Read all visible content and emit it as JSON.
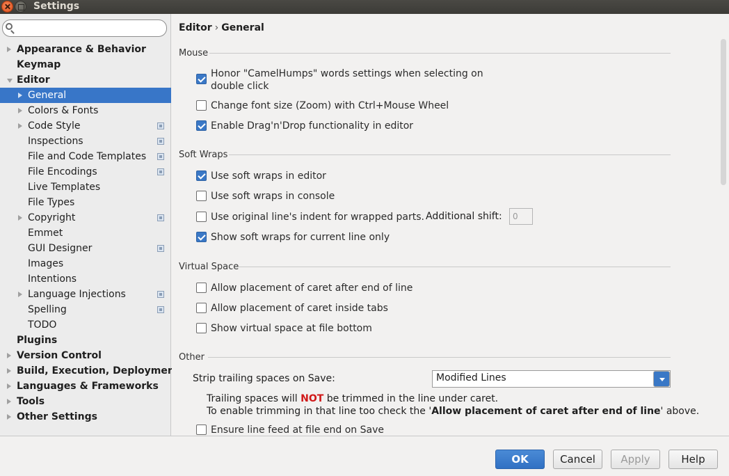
{
  "window": {
    "title": "Settings"
  },
  "search": {
    "placeholder": "",
    "icon": "search-icon"
  },
  "sidebar": {
    "items": [
      {
        "label": "Appearance & Behavior",
        "level": 0,
        "arrow": "right",
        "proj": false,
        "selected": false
      },
      {
        "label": "Keymap",
        "level": 0,
        "arrow": "none",
        "proj": false,
        "selected": false
      },
      {
        "label": "Editor",
        "level": 0,
        "arrow": "down",
        "proj": false,
        "selected": false
      },
      {
        "label": "General",
        "level": 1,
        "arrow": "right",
        "proj": false,
        "selected": true
      },
      {
        "label": "Colors & Fonts",
        "level": 1,
        "arrow": "right",
        "proj": false,
        "selected": false
      },
      {
        "label": "Code Style",
        "level": 1,
        "arrow": "right",
        "proj": true,
        "selected": false
      },
      {
        "label": "Inspections",
        "level": 1,
        "arrow": "none",
        "proj": true,
        "selected": false
      },
      {
        "label": "File and Code Templates",
        "level": 1,
        "arrow": "none",
        "proj": true,
        "selected": false
      },
      {
        "label": "File Encodings",
        "level": 1,
        "arrow": "none",
        "proj": true,
        "selected": false
      },
      {
        "label": "Live Templates",
        "level": 1,
        "arrow": "none",
        "proj": false,
        "selected": false
      },
      {
        "label": "File Types",
        "level": 1,
        "arrow": "none",
        "proj": false,
        "selected": false
      },
      {
        "label": "Copyright",
        "level": 1,
        "arrow": "right",
        "proj": true,
        "selected": false
      },
      {
        "label": "Emmet",
        "level": 1,
        "arrow": "none",
        "proj": false,
        "selected": false
      },
      {
        "label": "GUI Designer",
        "level": 1,
        "arrow": "none",
        "proj": true,
        "selected": false
      },
      {
        "label": "Images",
        "level": 1,
        "arrow": "none",
        "proj": false,
        "selected": false
      },
      {
        "label": "Intentions",
        "level": 1,
        "arrow": "none",
        "proj": false,
        "selected": false
      },
      {
        "label": "Language Injections",
        "level": 1,
        "arrow": "right",
        "proj": true,
        "selected": false
      },
      {
        "label": "Spelling",
        "level": 1,
        "arrow": "none",
        "proj": true,
        "selected": false
      },
      {
        "label": "TODO",
        "level": 1,
        "arrow": "none",
        "proj": false,
        "selected": false
      },
      {
        "label": "Plugins",
        "level": 0,
        "arrow": "none",
        "proj": false,
        "selected": false
      },
      {
        "label": "Version Control",
        "level": 0,
        "arrow": "right",
        "proj": false,
        "selected": false
      },
      {
        "label": "Build, Execution, Deployment",
        "level": 0,
        "arrow": "right",
        "proj": false,
        "selected": false
      },
      {
        "label": "Languages & Frameworks",
        "level": 0,
        "arrow": "right",
        "proj": false,
        "selected": false
      },
      {
        "label": "Tools",
        "level": 0,
        "arrow": "right",
        "proj": false,
        "selected": false
      },
      {
        "label": "Other Settings",
        "level": 0,
        "arrow": "right",
        "proj": false,
        "selected": false
      }
    ]
  },
  "breadcrumb": {
    "parent": "Editor",
    "sep": "›",
    "current": "General"
  },
  "sections": {
    "mouse": "Mouse",
    "soft_wraps": "Soft Wraps",
    "virtual_space": "Virtual Space",
    "other": "Other"
  },
  "options": {
    "camel_humps_l1": "Honor \"CamelHumps\" words settings when selecting on",
    "camel_humps_l2": "double click",
    "camel_humps": true,
    "zoom": "Change font size (Zoom) with Ctrl+Mouse Wheel",
    "zoom_checked": false,
    "dnd": "Enable Drag'n'Drop functionality in editor",
    "dnd_checked": true,
    "wrap_editor": "Use soft wraps in editor",
    "wrap_editor_checked": true,
    "wrap_console": "Use soft wraps in console",
    "wrap_console_checked": false,
    "orig_indent": "Use original line's indent for wrapped parts.",
    "orig_indent_checked": false,
    "additional_shift_label": "Additional shift:",
    "additional_shift_value": "0",
    "wrap_current": "Show soft wraps for current line only",
    "wrap_current_checked": true,
    "caret_after_eol": "Allow placement of caret after end of line",
    "caret_after_eol_checked": false,
    "caret_tabs": "Allow placement of caret inside tabs",
    "caret_tabs_checked": false,
    "virtual_bottom": "Show virtual space at file bottom",
    "virtual_bottom_checked": false,
    "strip_label": "Strip trailing spaces on Save:",
    "strip_value": "Modified Lines",
    "note1_pre": "Trailing spaces will",
    "note1_not": "NOT",
    "note1_post": "be trimmed in the line under caret.",
    "note2_pre": "To enable trimming in that line too check the '",
    "note2_bold": "Allow placement of caret after end of line",
    "note2_post": "' above.",
    "line_feed": "Ensure line feed at file end on Save",
    "line_feed_checked": false
  },
  "buttons": {
    "ok": "OK",
    "cancel": "Cancel",
    "apply": "Apply",
    "help": "Help"
  },
  "colors": {
    "accent": "#3876c8",
    "warning": "#d01818"
  }
}
